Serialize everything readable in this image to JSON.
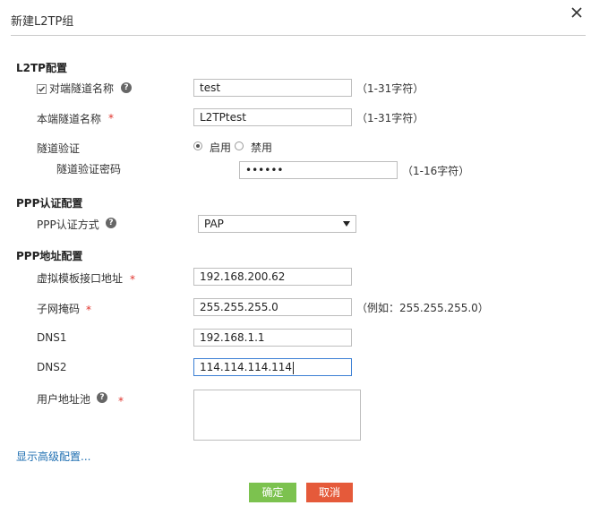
{
  "dialog": {
    "title": "新建L2TP组",
    "close_icon": "close-icon"
  },
  "l2tp": {
    "section_title": "L2TP配置",
    "peer_tunnel_name": {
      "label": "对端隧道名称",
      "checked": true,
      "value": "test",
      "hint": "（1-31字符）"
    },
    "local_tunnel_name": {
      "label": "本端隧道名称",
      "required_mark": "*",
      "value": "L2TPtest",
      "hint": "（1-31字符）"
    },
    "tunnel_auth": {
      "label": "隧道验证",
      "options": [
        "启用",
        "禁用"
      ],
      "selected": "启用"
    },
    "tunnel_auth_password": {
      "label": "隧道验证密码",
      "value": "••••••",
      "hint": "（1-16字符）"
    }
  },
  "ppp_auth": {
    "section_title": "PPP认证配置",
    "auth_method": {
      "label": "PPP认证方式",
      "value": "PAP"
    }
  },
  "ppp_address": {
    "section_title": "PPP地址配置",
    "vt_address": {
      "label": "虚拟模板接口地址",
      "required_mark": "*",
      "value": "192.168.200.62"
    },
    "subnet_mask": {
      "label": "子网掩码",
      "required_mark": "*",
      "value": "255.255.255.0",
      "hint": "（例如：255.255.255.0）"
    },
    "dns1": {
      "label": "DNS1",
      "value": "192.168.1.1"
    },
    "dns2": {
      "label": "DNS2",
      "value": "114.114.114.114"
    },
    "user_pool": {
      "label": "用户地址池",
      "required_mark": "*",
      "value": ""
    }
  },
  "advanced_link": "显示高级配置...",
  "buttons": {
    "ok": "确定",
    "cancel": "取消"
  },
  "colors": {
    "ok": "#7cc24f",
    "cancel": "#e55a3a",
    "link": "#1f6fb2",
    "required": "#e0322b",
    "focus": "#3b7fd4"
  }
}
